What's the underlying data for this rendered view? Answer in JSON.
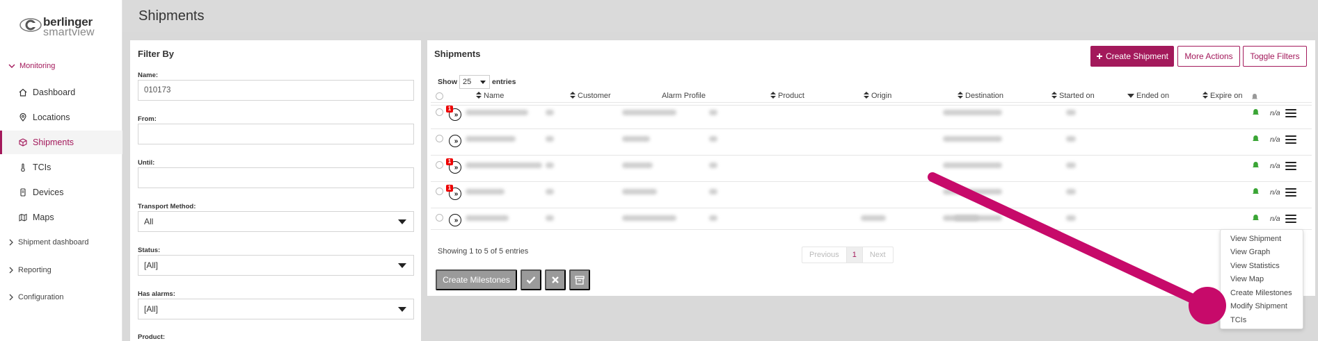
{
  "app": {
    "logo_line1": "berlinger",
    "logo_line2": "smartview",
    "brand_color": "#a3195b"
  },
  "sidebar": {
    "monitoring_label": "Monitoring",
    "items": [
      {
        "label": "Dashboard",
        "icon": "home-icon"
      },
      {
        "label": "Locations",
        "icon": "location-pin-icon"
      },
      {
        "label": "Shipments",
        "icon": "box-icon",
        "active": true
      },
      {
        "label": "TCIs",
        "icon": "thermometer-icon"
      },
      {
        "label": "Devices",
        "icon": "device-icon"
      },
      {
        "label": "Maps",
        "icon": "map-icon"
      }
    ],
    "groups": [
      "Shipment dashboard",
      "Reporting",
      "Configuration"
    ]
  },
  "header": {
    "title": "Shipments"
  },
  "filter": {
    "title": "Filter By",
    "name_label": "Name:",
    "name_value": "010173",
    "from_label": "From:",
    "until_label": "Until:",
    "transport_label": "Transport Method:",
    "transport_value": "All",
    "status_label": "Status:",
    "status_value": "[All]",
    "alarms_label": "Has alarms:",
    "alarms_value": "[All]",
    "product_label": "Product:"
  },
  "panel": {
    "title": "Shipments",
    "create_label": "Create Shipment",
    "more_actions_label": "More Actions",
    "toggle_filters_label": "Toggle Filters",
    "show_label": "Show",
    "entries_value": "25",
    "entries_label": "entries",
    "columns": [
      "Name",
      "Customer",
      "Alarm Profile",
      "Product",
      "Origin",
      "Destination",
      "Started on",
      "Ended on",
      "Expire on"
    ],
    "rows": [
      {
        "alarm_badge": "1",
        "status": "n/a"
      },
      {
        "alarm_badge": "",
        "status": "n/a"
      },
      {
        "alarm_badge": "1",
        "status": "n/a"
      },
      {
        "alarm_badge": "1",
        "status": "n/a"
      },
      {
        "alarm_badge": "",
        "status": "n/a"
      }
    ],
    "showing_text": "Showing 1 to 5 of 5 entries",
    "pager": {
      "previous": "Previous",
      "current": "1",
      "next": "Next"
    },
    "create_milestones_label": "Create Milestones"
  },
  "context_menu": {
    "items": [
      "View Shipment",
      "View Graph",
      "View Statistics",
      "View Map",
      "Create Milestones",
      "Modify Shipment",
      "TCIs"
    ]
  }
}
